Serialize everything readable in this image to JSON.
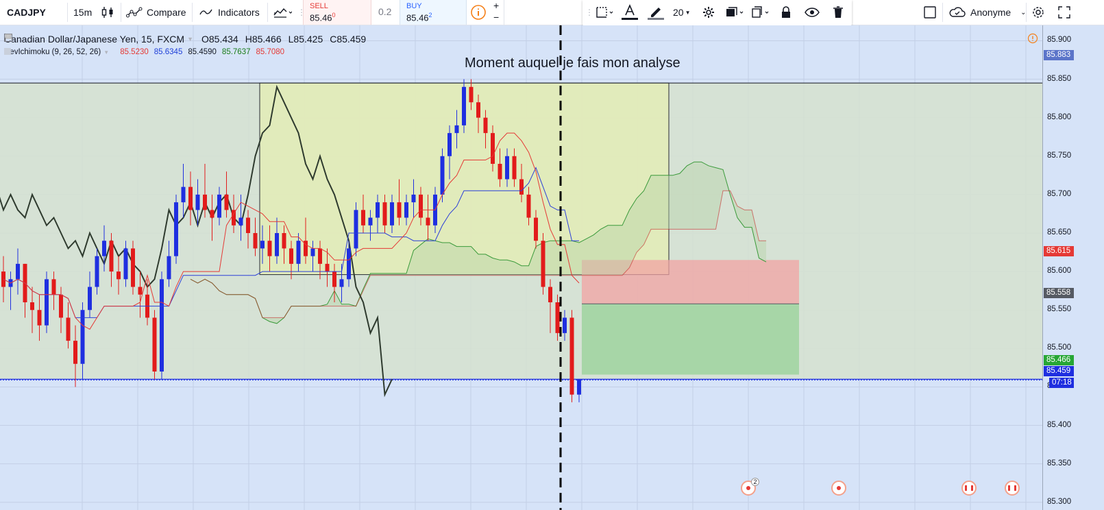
{
  "toolbar": {
    "symbol": "CADJPY",
    "interval": "15m",
    "compare_label": "Compare",
    "indicators_label": "Indicators",
    "sell_label": "SELL",
    "sell_price": "85.46",
    "sell_sup": "0",
    "spread": "0.2",
    "buy_label": "BUY",
    "buy_price": "85.46",
    "buy_sup": "2",
    "plus": "+",
    "minus": "−",
    "font_size": "20",
    "user_label": "Anonyme"
  },
  "legend": {
    "title": "Canadian Dollar/Japanese Yen, 15, FXCM",
    "open": "O85.434",
    "high": "H85.466",
    "low": "L85.425",
    "close": "C85.459"
  },
  "indicator": {
    "name": "RevIchimoku (9, 26, 52, 26)",
    "values": [
      {
        "text": "85.5230",
        "color": "#e53935"
      },
      {
        "text": "85.6345",
        "color": "#1e3fd8"
      },
      {
        "text": "85.4590",
        "color": "#131722"
      },
      {
        "text": "85.7637",
        "color": "#1b7d1b"
      },
      {
        "text": "85.7080",
        "color": "#e53935"
      }
    ]
  },
  "annotation": "Moment auquel je fais mon analyse",
  "price_scale": {
    "ticks": [
      "85.900",
      "85.850",
      "85.800",
      "85.750",
      "85.700",
      "85.650",
      "85.600",
      "85.550",
      "85.500",
      "85.450",
      "85.400",
      "85.350",
      "85.300"
    ],
    "tags": [
      {
        "text": "85.883",
        "color": "#5b74c9"
      },
      {
        "text": "85.615",
        "color": "#e53935"
      },
      {
        "text": "85.558",
        "color": "#555a63"
      },
      {
        "text": "85.466",
        "color": "#26a634"
      },
      {
        "text": "85.459",
        "color": "#1f2fe0"
      },
      {
        "text": "07:18",
        "color": "#1f2fe0"
      }
    ]
  },
  "event_badge_count": "2",
  "colors": {
    "up": "#1f2fe0",
    "down": "#e21b1b",
    "tenkan": "#e53935",
    "kijun": "#2b3fd8",
    "chikou": "#2e3a2e",
    "span_a": "#3a9a3a",
    "span_b": "#c62828",
    "box": "#e3ecb9",
    "stop_zone": "#f2a3a3",
    "target_zone": "#9fd39f"
  },
  "chart_data": {
    "type": "candlestick",
    "symbol": "CADJPY",
    "interval": "15",
    "ylim": [
      85.29,
      85.92
    ],
    "last_price": 85.459,
    "annotation_line": "vertical dashed line at analysis moment",
    "position": {
      "entry": 85.558,
      "stop": 85.615,
      "target": 85.466
    },
    "horizontal_levels": [
      85.845,
      85.46
    ],
    "candles": [
      [
        85.6,
        85.62,
        85.56,
        85.58
      ],
      [
        85.58,
        85.6,
        85.55,
        85.59
      ],
      [
        85.59,
        85.63,
        85.57,
        85.61
      ],
      [
        85.61,
        85.61,
        85.54,
        85.56
      ],
      [
        85.56,
        85.58,
        85.52,
        85.55
      ],
      [
        85.55,
        85.57,
        85.51,
        85.53
      ],
      [
        85.53,
        85.6,
        85.52,
        85.59
      ],
      [
        85.59,
        85.6,
        85.55,
        85.57
      ],
      [
        85.57,
        85.58,
        85.52,
        85.54
      ],
      [
        85.54,
        85.56,
        85.5,
        85.51
      ],
      [
        85.51,
        85.53,
        85.45,
        85.48
      ],
      [
        85.48,
        85.56,
        85.46,
        85.55
      ],
      [
        85.55,
        85.6,
        85.54,
        85.58
      ],
      [
        85.58,
        85.63,
        85.57,
        85.62
      ],
      [
        85.62,
        85.66,
        85.6,
        85.64
      ],
      [
        85.64,
        85.65,
        85.58,
        85.6
      ],
      [
        85.6,
        85.62,
        85.57,
        85.59
      ],
      [
        85.59,
        85.64,
        85.58,
        85.63
      ],
      [
        85.63,
        85.64,
        85.57,
        85.58
      ],
      [
        85.58,
        85.6,
        85.54,
        85.57
      ],
      [
        85.57,
        85.59,
        85.53,
        85.54
      ],
      [
        85.54,
        85.55,
        85.46,
        85.47
      ],
      [
        85.47,
        85.6,
        85.46,
        85.59
      ],
      [
        85.59,
        85.64,
        85.58,
        85.62
      ],
      [
        85.62,
        85.7,
        85.61,
        85.69
      ],
      [
        85.69,
        85.74,
        85.67,
        85.71
      ],
      [
        85.71,
        85.73,
        85.66,
        85.68
      ],
      [
        85.68,
        85.72,
        85.66,
        85.7
      ],
      [
        85.7,
        85.74,
        85.67,
        85.68
      ],
      [
        85.68,
        85.7,
        85.64,
        85.67
      ],
      [
        85.67,
        85.71,
        85.66,
        85.7
      ],
      [
        85.7,
        85.73,
        85.67,
        85.68
      ],
      [
        85.68,
        85.7,
        85.65,
        85.66
      ],
      [
        85.66,
        85.7,
        85.64,
        85.67
      ],
      [
        85.67,
        85.68,
        85.63,
        85.65
      ],
      [
        85.65,
        85.67,
        85.62,
        85.63
      ],
      [
        85.63,
        85.66,
        85.61,
        85.64
      ],
      [
        85.64,
        85.66,
        85.6,
        85.62
      ],
      [
        85.62,
        85.67,
        85.61,
        85.65
      ],
      [
        85.65,
        85.66,
        85.61,
        85.63
      ],
      [
        85.63,
        85.64,
        85.59,
        85.61
      ],
      [
        85.61,
        85.65,
        85.6,
        85.64
      ],
      [
        85.64,
        85.67,
        85.61,
        85.62
      ],
      [
        85.62,
        85.64,
        85.6,
        85.63
      ],
      [
        85.63,
        85.64,
        85.59,
        85.61
      ],
      [
        85.61,
        85.63,
        85.58,
        85.6
      ],
      [
        85.6,
        85.61,
        85.56,
        85.58
      ],
      [
        85.58,
        85.61,
        85.56,
        85.59
      ],
      [
        85.59,
        85.64,
        85.58,
        85.63
      ],
      [
        85.63,
        85.69,
        85.62,
        85.68
      ],
      [
        85.68,
        85.7,
        85.65,
        85.66
      ],
      [
        85.66,
        85.68,
        85.64,
        85.67
      ],
      [
        85.67,
        85.7,
        85.65,
        85.69
      ],
      [
        85.69,
        85.7,
        85.65,
        85.66
      ],
      [
        85.66,
        85.7,
        85.65,
        85.69
      ],
      [
        85.69,
        85.72,
        85.66,
        85.67
      ],
      [
        85.67,
        85.7,
        85.66,
        85.69
      ],
      [
        85.69,
        85.72,
        85.67,
        85.7
      ],
      [
        85.7,
        85.71,
        85.66,
        85.67
      ],
      [
        85.67,
        85.7,
        85.64,
        85.66
      ],
      [
        85.66,
        85.71,
        85.65,
        85.7
      ],
      [
        85.7,
        85.76,
        85.69,
        85.75
      ],
      [
        85.75,
        85.79,
        85.72,
        85.78
      ],
      [
        85.78,
        85.81,
        85.76,
        85.79
      ],
      [
        85.79,
        85.85,
        85.78,
        85.84
      ],
      [
        85.84,
        85.85,
        85.81,
        85.82
      ],
      [
        85.82,
        85.83,
        85.78,
        85.8
      ],
      [
        85.8,
        85.81,
        85.76,
        85.78
      ],
      [
        85.78,
        85.79,
        85.73,
        85.74
      ],
      [
        85.74,
        85.76,
        85.71,
        85.72
      ],
      [
        85.72,
        85.76,
        85.71,
        85.75
      ],
      [
        85.75,
        85.76,
        85.71,
        85.72
      ],
      [
        85.72,
        85.74,
        85.69,
        85.7
      ],
      [
        85.7,
        85.71,
        85.66,
        85.67
      ],
      [
        85.67,
        85.68,
        85.63,
        85.64
      ],
      [
        85.64,
        85.65,
        85.57,
        85.58
      ],
      [
        85.58,
        85.59,
        85.52,
        85.56
      ],
      [
        85.56,
        85.57,
        85.51,
        85.52
      ],
      [
        85.52,
        85.55,
        85.51,
        85.54
      ],
      [
        85.54,
        85.55,
        85.43,
        85.44
      ],
      [
        85.44,
        85.46,
        85.43,
        85.46
      ]
    ]
  }
}
